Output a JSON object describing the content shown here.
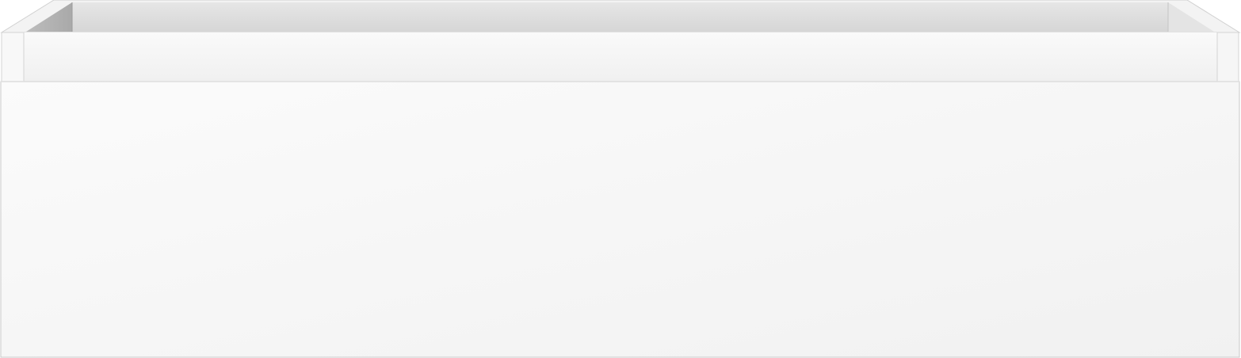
{
  "object": {
    "kind": "open-top rectangular box (drawer front)",
    "colors": {
      "background": "#ffffff",
      "rim_light": "#f4f4f4",
      "inner_back": "#dcdcdc",
      "inner_shadow": "#aeaeae",
      "front_panel_top": "#fbfbfb",
      "front_panel_bottom": "#f2f2f2",
      "edge_line": "#c8c8c8"
    }
  }
}
